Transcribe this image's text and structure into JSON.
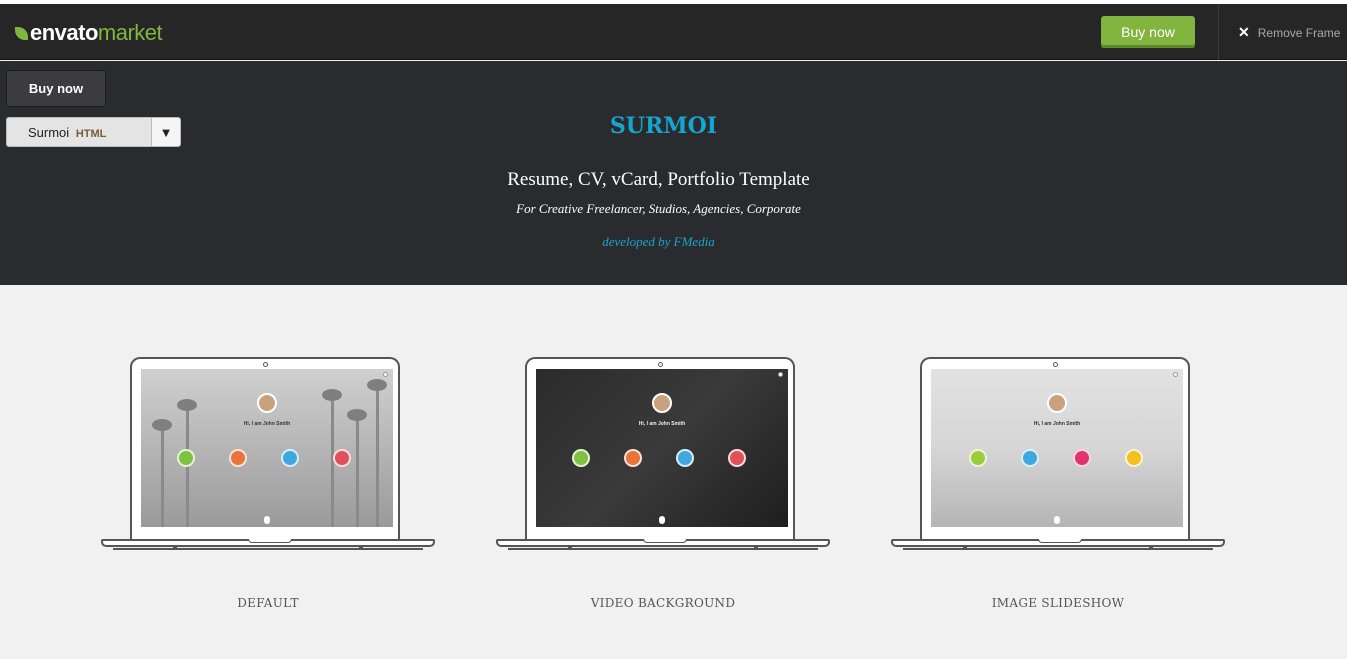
{
  "envato_bar": {
    "logo_envato": "envato",
    "logo_market": "market",
    "buy_label": "Buy now",
    "remove_frame_label": "Remove Frame",
    "remove_icon": "close-icon",
    "accent": "#82b440"
  },
  "theme_controls": {
    "buy_label": "Buy now",
    "select_name": "Surmoi",
    "select_tag": "HTML",
    "select_arrow": "▼"
  },
  "hero": {
    "title": "SURMOI",
    "subtitle": "Resume, CV, vCard, Portfolio Template",
    "tagline": "For Creative Freelancer, Studios, Agencies, Corporate",
    "developer": "developed by FMedia",
    "accent": "#15a6cf"
  },
  "demos": [
    {
      "caption": "DEFAULT",
      "greeting": "Hi, I am John Smith"
    },
    {
      "caption": "VIDEO BACKGROUND",
      "greeting": "Hi, I am John Smith"
    },
    {
      "caption": "IMAGE SLIDESHOW",
      "greeting": "Hi, I am John Smith"
    }
  ]
}
